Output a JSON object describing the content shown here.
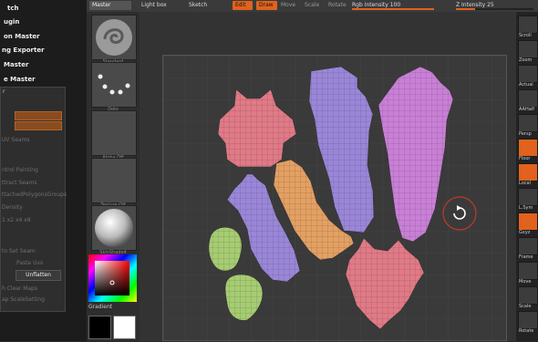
{
  "left_menu": {
    "items": [
      "tch",
      "ugin",
      "on Master",
      "ng Exporter",
      "Master",
      "e Master"
    ]
  },
  "subpanel": {
    "top_label": "r",
    "dim_rows": [
      "UV Seams",
      "ntrol Painting",
      "ttract Seams",
      "ttachedPolygonsGroups",
      "Density",
      "1   x2   x4   x8",
      "to  Set Seam",
      "Paste Uvs",
      "h    Clear Maps",
      "ap  ScaleSetting"
    ],
    "unflatten_label": "Unflatten"
  },
  "toolbar": {
    "material_label": "Master",
    "light_box_label": "Light box",
    "sketch_label": "Sketch",
    "edit_label": "Edit",
    "draw_label": "Draw",
    "move_label": "Move",
    "scale_label": "Scale",
    "rotate_label": "Rotate",
    "rgb_intensity_label": "Rgb Intensity",
    "rgb_intensity_value": "100",
    "z_intensity_label": "Z Intensity",
    "z_intensity_value": "25",
    "rgb_intensity_fraction": 1.0,
    "z_intensity_fraction": 0.25
  },
  "palette": {
    "tiles": [
      "Standard",
      "Dots",
      "Alpha Off",
      "Texture Off",
      "SkinShade4"
    ],
    "gradient_label": "Gradient"
  },
  "right_shelf": {
    "labels": [
      "Scroll",
      "Zoom",
      "Actual",
      "AAHalf",
      "Persp",
      "Floor",
      "Local",
      "L.Sym",
      "Gxyz",
      "Frame",
      "Move",
      "Scale",
      "Rotate"
    ]
  },
  "colors": {
    "accent": "#e0621e",
    "pink_island": "#e07a86",
    "purple_island": "#9a86d8",
    "violet_island": "#c97fd6",
    "orange_island": "#e3a062",
    "green_island": "#a6cc72",
    "rotate_cursor": "#c0392b"
  }
}
